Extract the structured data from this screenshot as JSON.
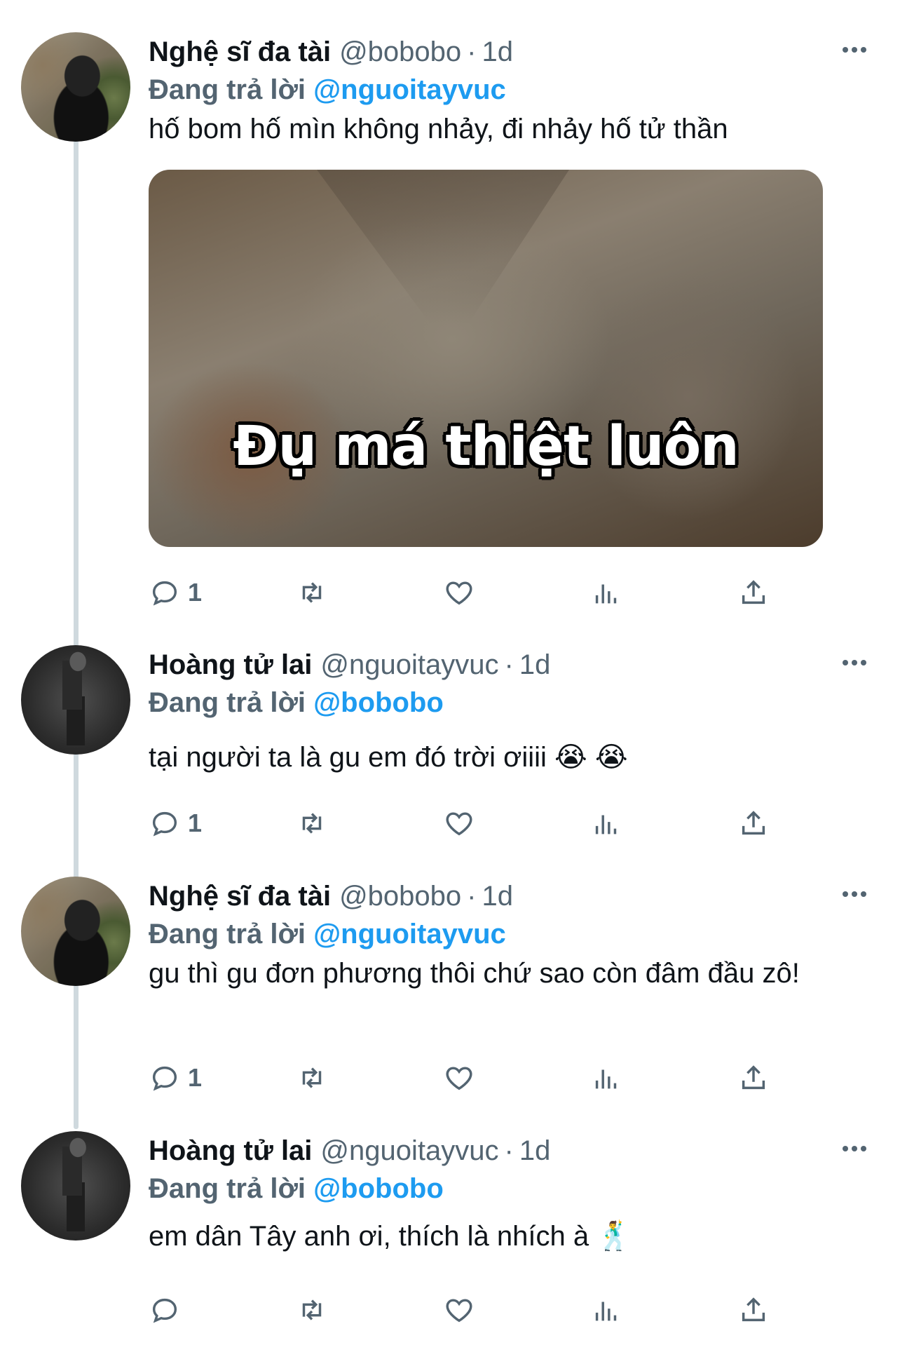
{
  "tweets": [
    {
      "name": "Nghệ sĩ đa tài",
      "handle": "@bobobo",
      "time": "1d",
      "reply_label": "Đang trả lời",
      "reply_to": "@nguoitayvuc",
      "text": "hố bom hố mìn không nhảy, đi nhảy hố tử thần",
      "media_caption": "Đụ má thiệt luôn",
      "reply_count": "1"
    },
    {
      "name": "Hoàng tử lai",
      "handle": "@nguoitayvuc",
      "time": "1d",
      "reply_label": "Đang trả lời",
      "reply_to": "@bobobo",
      "text": "tại người ta là gu em đó trời ơiiii 😭 😭",
      "reply_count": "1"
    },
    {
      "name": "Nghệ sĩ đa tài",
      "handle": "@bobobo",
      "time": "1d",
      "reply_label": "Đang trả lời",
      "reply_to": "@nguoitayvuc",
      "text": "gu thì gu đơn phương thôi chứ sao còn đâm đầu zô!",
      "reply_count": "1"
    },
    {
      "name": "Hoàng tử lai",
      "handle": "@nguoitayvuc",
      "time": "1d",
      "reply_label": "Đang trả lời",
      "reply_to": "@bobobo",
      "text": "em dân Tây anh ơi, thích là nhích à 🕺",
      "reply_count": ""
    }
  ],
  "separator": "·",
  "icons": [
    "reply-icon",
    "retweet-icon",
    "like-icon",
    "views-icon",
    "share-icon",
    "more-icon"
  ],
  "colors": {
    "accent": "#1d9bf0",
    "secondary_text": "#536471",
    "primary_text": "#0f1419",
    "thread_line": "#cfd9de"
  }
}
